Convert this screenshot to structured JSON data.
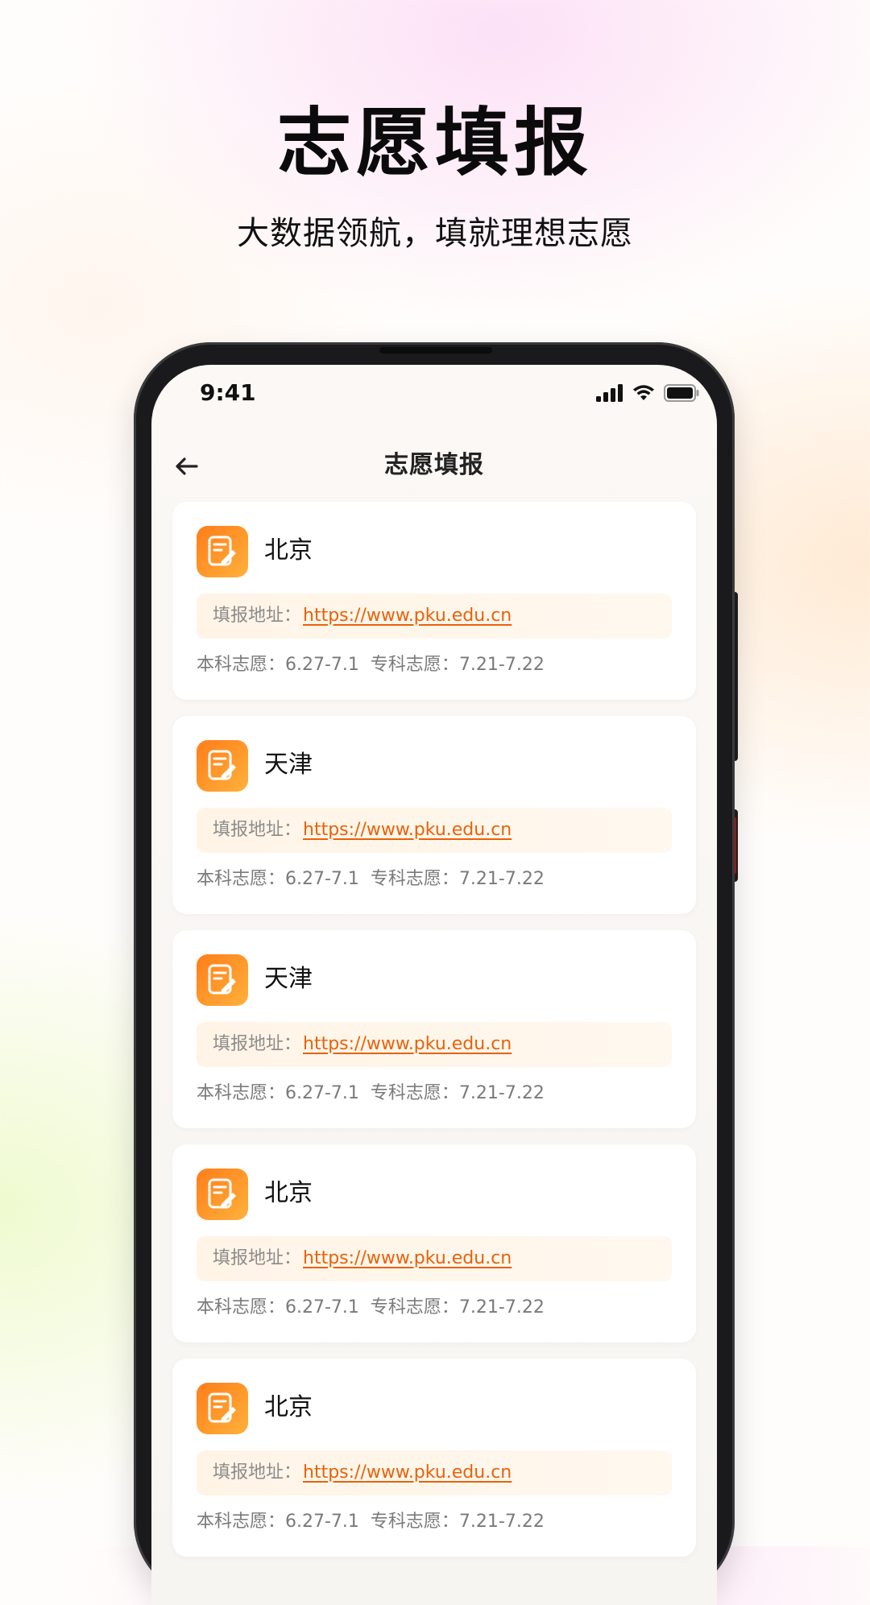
{
  "hero": {
    "title": "志愿填报",
    "subtitle": "大数据领航，填就理想志愿"
  },
  "status_bar": {
    "time": "9:41",
    "icons": [
      "signal-icon",
      "wifi-icon",
      "battery-icon"
    ]
  },
  "nav": {
    "title": "志愿填报",
    "back_icon": "arrow-left-icon"
  },
  "accent_color": "#ff7d1a",
  "link_color": "#e8620a",
  "cards": [
    {
      "title": "北京",
      "link_label": "填报地址：",
      "url": "https://www.pku.edu.cn",
      "undergrad": "本科志愿：6.27-7.1",
      "junior": "专科志愿：7.21-7.22"
    },
    {
      "title": "天津",
      "link_label": "填报地址：",
      "url": "https://www.pku.edu.cn",
      "undergrad": "本科志愿：6.27-7.1",
      "junior": "专科志愿：7.21-7.22"
    },
    {
      "title": "天津",
      "link_label": "填报地址：",
      "url": "https://www.pku.edu.cn",
      "undergrad": "本科志愿：6.27-7.1",
      "junior": "专科志愿：7.21-7.22"
    },
    {
      "title": "北京",
      "link_label": "填报地址：",
      "url": "https://www.pku.edu.cn",
      "undergrad": "本科志愿：6.27-7.1",
      "junior": "专科志愿：7.21-7.22"
    },
    {
      "title": "北京",
      "link_label": "填报地址：",
      "url": "https://www.pku.edu.cn",
      "undergrad": "本科志愿：6.27-7.1",
      "junior": "专科志愿：7.21-7.22"
    }
  ]
}
